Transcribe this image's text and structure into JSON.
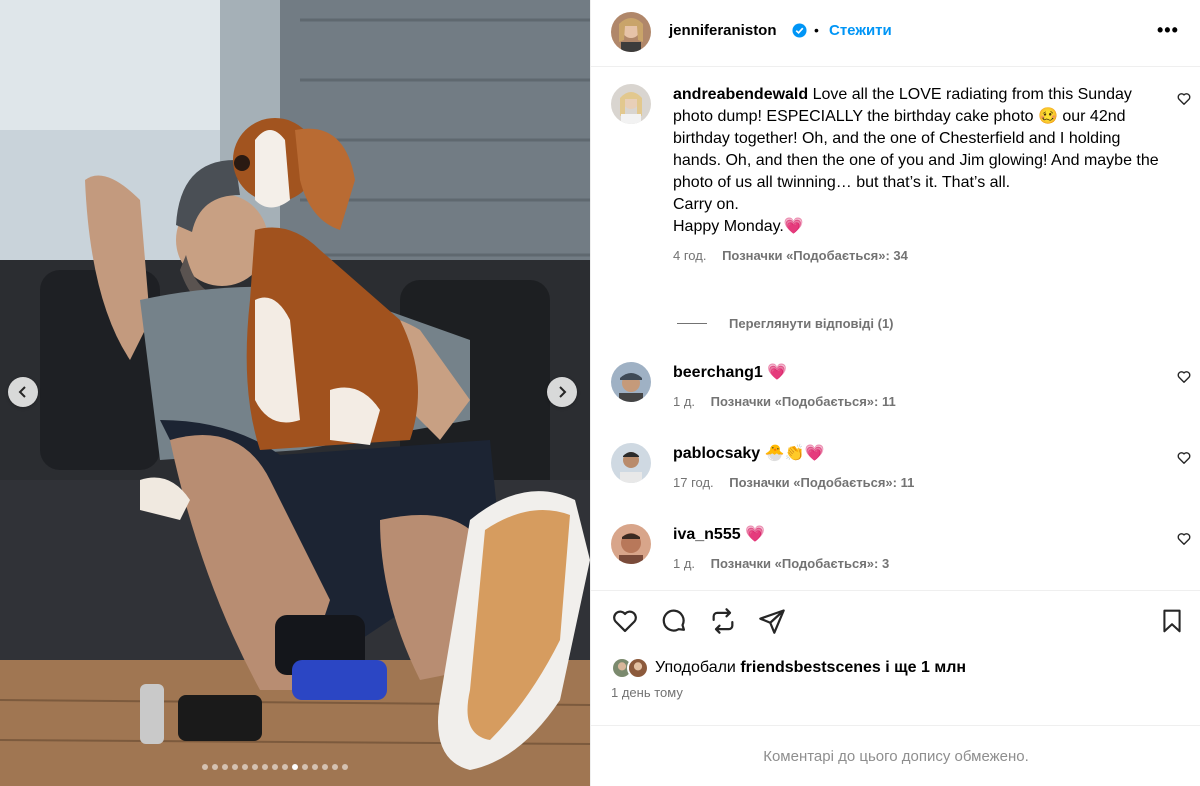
{
  "post": {
    "author": "jenniferaniston",
    "follow_label": "Стежити",
    "separator": "•",
    "more_label": "•••",
    "carousel": {
      "total_slides": 15,
      "active_slide": 10
    }
  },
  "comments": [
    {
      "username": "andreabendewald",
      "lines": [
        "Love all the LOVE radiating from this Sunday photo dump! ESPECIALLY the birthday cake photo 🥴 our 42nd birthday together! Oh, and the one of Chesterfield and I holding hands. Oh, and then the one of you and Jim glowing! And maybe the photo of us all twinning… but that’s it. That’s all.",
        "Carry on.",
        "Happy Monday.💗"
      ],
      "time": "4 год.",
      "likes": "Позначки «Подобається»: 34",
      "view_replies": "Переглянути відповіді (1)"
    },
    {
      "username": "beerchang1",
      "text": "💗",
      "time": "1 д.",
      "likes": "Позначки «Подобається»: 11"
    },
    {
      "username": "pablocsaky",
      "text": "🐣👏💗",
      "time": "17 год.",
      "likes": "Позначки «Подобається»: 11"
    },
    {
      "username": "iva_n555",
      "text": "💗",
      "time": "1 д.",
      "likes": "Позначки «Подобається»: 3"
    }
  ],
  "footer": {
    "liked_prefix": "Уподобали",
    "liked_user": "friendsbestscenes",
    "liked_suffix": "і ще 1 млн",
    "time_ago": "1 день тому",
    "comments_restricted": "Коментарі до цього допису обмежено."
  },
  "colors": {
    "accent_blue": "#0095f6",
    "muted_text": "#737373",
    "divider": "#efefef",
    "heart_pink": "#f03b7a"
  }
}
